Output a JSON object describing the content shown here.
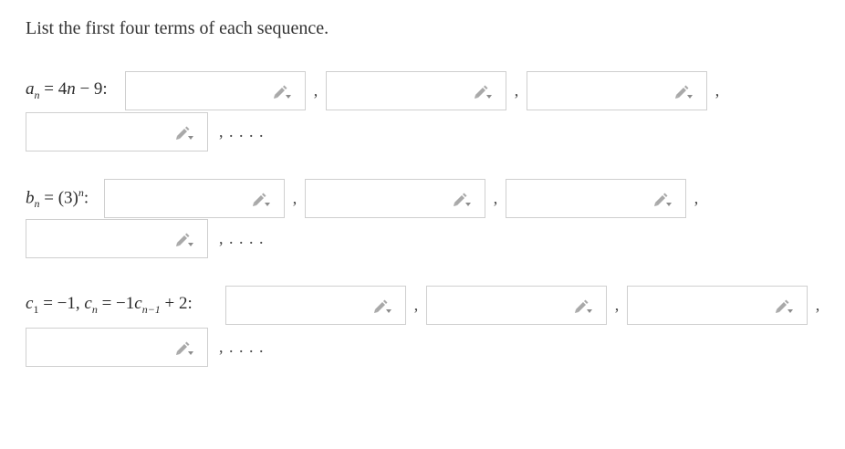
{
  "instruction": "List the first four terms of each sequence.",
  "icons": {
    "edit": "pencil-dropdown-icon"
  },
  "separators": {
    "comma": ",",
    "ellipsis": ", . . . ."
  },
  "problems": [
    {
      "id": "a",
      "label_parts": [
        "a",
        "n",
        " = 4",
        "n",
        " − 9:"
      ]
    },
    {
      "id": "b",
      "label_parts": [
        "b",
        "n",
        " = (3)",
        "n",
        ":"
      ]
    },
    {
      "id": "c",
      "label_parts": [
        "c",
        "1",
        " = −1, ",
        "c",
        "n",
        " = −1",
        "c",
        "n−1",
        " + 2:"
      ]
    }
  ]
}
